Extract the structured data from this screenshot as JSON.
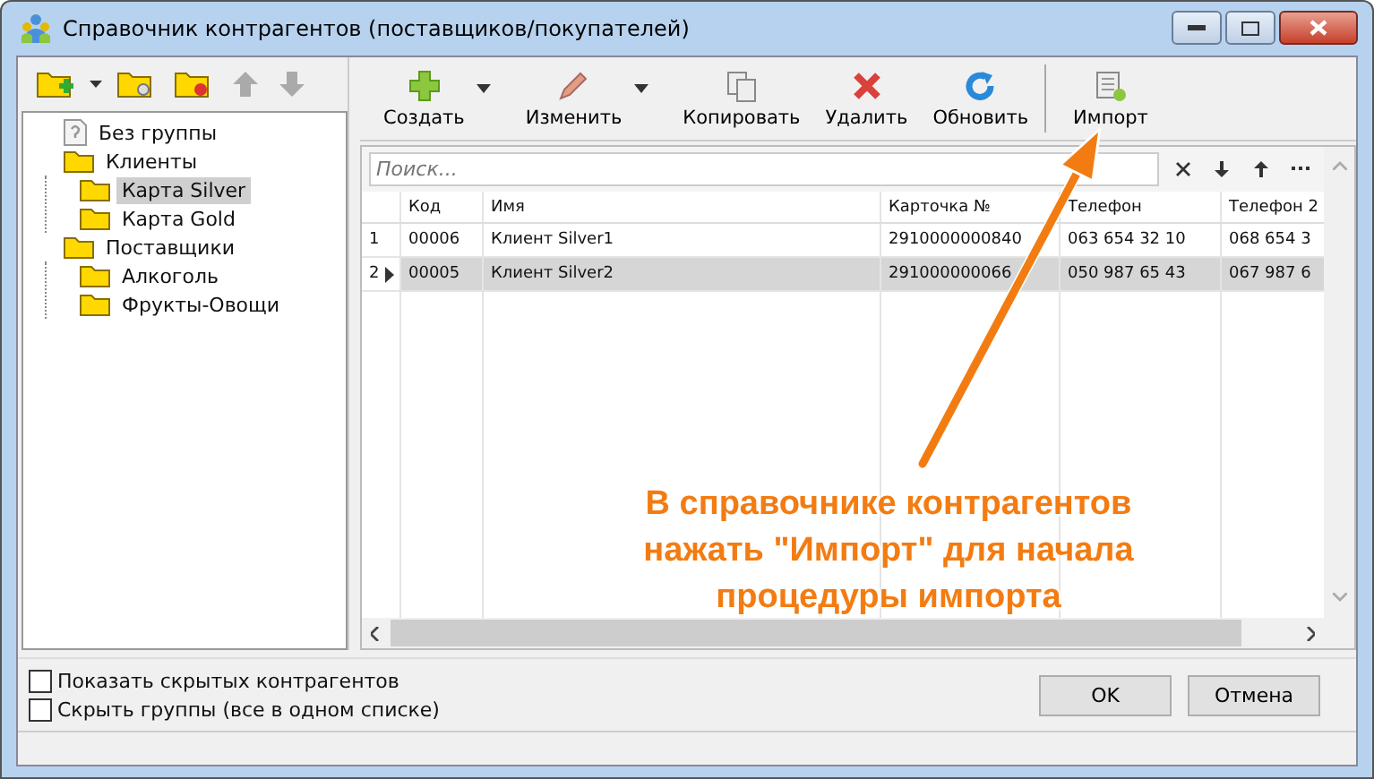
{
  "window": {
    "title": "Справочник контрагентов (поставщиков/покупателей)"
  },
  "tree": [
    {
      "label": "Без группы",
      "kind": "none",
      "selected": false
    },
    {
      "label": "Клиенты",
      "kind": "folder",
      "selected": false,
      "expanded": true,
      "children": [
        {
          "label": "Карта Silver",
          "kind": "folder",
          "selected": true
        },
        {
          "label": "Карта Gold",
          "kind": "folder",
          "selected": false
        }
      ]
    },
    {
      "label": "Поставщики",
      "kind": "folder",
      "selected": false,
      "expanded": true,
      "children": [
        {
          "label": "Алкоголь",
          "kind": "folder",
          "selected": false
        },
        {
          "label": "Фрукты-Овощи",
          "kind": "folder",
          "selected": false
        }
      ]
    }
  ],
  "toolbar": [
    {
      "label": "Создать",
      "kind": "create",
      "dropdown": true
    },
    {
      "label": "Изменить",
      "kind": "edit",
      "dropdown": true
    },
    {
      "label": "Копировать",
      "kind": "copy",
      "dropdown": false
    },
    {
      "label": "Удалить",
      "kind": "delete",
      "dropdown": false
    },
    {
      "label": "Обновить",
      "kind": "refresh",
      "dropdown": false
    },
    {
      "label": "Импорт",
      "kind": "import",
      "dropdown": false
    }
  ],
  "search": {
    "placeholder": "Поиск..."
  },
  "table": {
    "columns": [
      "Код",
      "Имя",
      "Карточка №",
      "Телефон",
      "Телефон 2"
    ],
    "rows": [
      {
        "number": "1",
        "selected": false,
        "cells": [
          "00006",
          "Клиент Silver1",
          "2910000000840",
          "063 654 32 10",
          "068 654 3"
        ]
      },
      {
        "number": "2",
        "selected": true,
        "cells": [
          "00005",
          "Клиент Silver2",
          "291000000066",
          "050 987 65 43",
          "067 987 6"
        ]
      }
    ]
  },
  "options": [
    {
      "label": "Показать скрытых контрагентов",
      "checked": false
    },
    {
      "label": "Скрыть группы (все в одном списке)",
      "checked": false
    }
  ],
  "buttons": [
    "OK",
    "Отмена"
  ],
  "callout": {
    "lines": [
      "В справочнике контрагентов",
      "нажать \"Импорт\" для начала",
      "процедуры импорта"
    ]
  }
}
